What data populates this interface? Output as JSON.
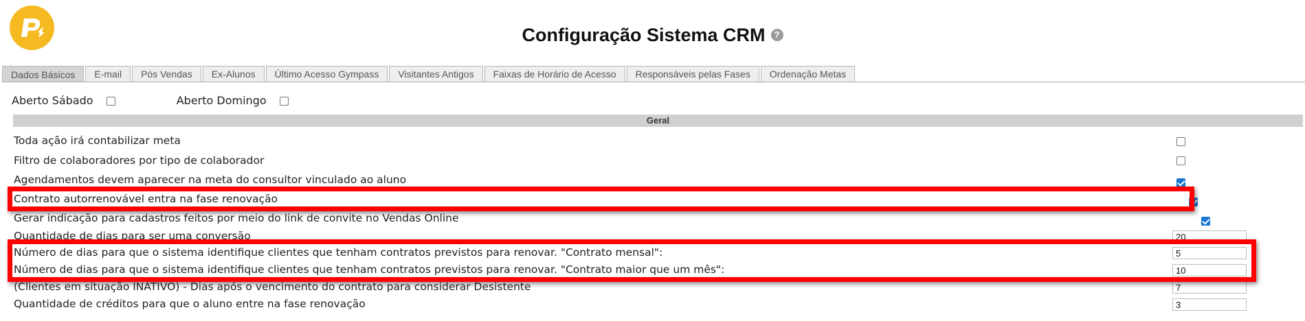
{
  "header": {
    "title": "Configuração Sistema CRM",
    "help_glyph": "?"
  },
  "logo": {
    "glyph": "P",
    "color": "#f5b921"
  },
  "tabs": [
    {
      "label": "Dados Básicos",
      "active": true
    },
    {
      "label": "E-mail"
    },
    {
      "label": "Pós Vendas"
    },
    {
      "label": "Ex-Alunos"
    },
    {
      "label": "Último Acesso Gympass"
    },
    {
      "label": "Visitantes Antigos"
    },
    {
      "label": "Faixas de Horário de Acesso"
    },
    {
      "label": "Responsáveis pelas Fases"
    },
    {
      "label": "Ordenação Metas"
    }
  ],
  "opening": {
    "saturday_label": "Aberto Sábado",
    "sunday_label": "Aberto Domingo",
    "saturday_checked": false,
    "sunday_checked": false
  },
  "section": {
    "title": "Geral"
  },
  "settings": [
    {
      "label": "Toda ação irá contabilizar meta",
      "checked": false
    },
    {
      "label": "Filtro de colaboradores por tipo de colaborador",
      "checked": false
    },
    {
      "label": "Agendamentos devem aparecer na meta do consultor vinculado ao aluno",
      "checked": true
    },
    {
      "label": "Contrato autorrenovável entra na fase renovação",
      "checked": true
    },
    {
      "label": "Gerar indicação para cadastros feitos por meio do link de convite no Vendas Online",
      "checked": true
    },
    {
      "label": "Quantidade de dias para ser uma conversão",
      "value": "20"
    },
    {
      "label": "Número de dias para que o sistema identifique clientes que tenham contratos previstos para renovar. \"Contrato mensal\":",
      "value": "5"
    },
    {
      "label": "Número de dias para que o sistema identifique clientes que tenham contratos previstos para renovar. \"Contrato maior que um mês\":",
      "value": "10"
    },
    {
      "label": "(Clientes em situação INATIVO) - Dias após o vencimento do contrato para considerar Desistente",
      "value": "7"
    },
    {
      "label": "Quantidade de créditos para que o aluno entre na fase renovação",
      "value": "3"
    }
  ],
  "colors": {
    "highlight": "#ff0000",
    "checkbox_checked": "#1976d2",
    "section_bar": "#d0d0d0"
  }
}
